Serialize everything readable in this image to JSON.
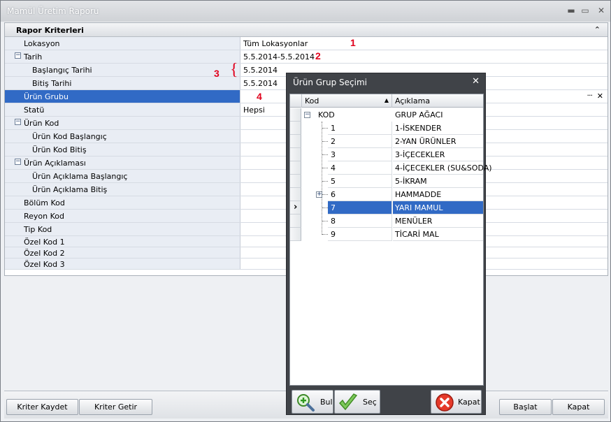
{
  "window": {
    "title": "Mamül Üretim Raporu"
  },
  "panel": {
    "title": "Rapor Kriterleri"
  },
  "rows": [
    {
      "label": "Lokasyon",
      "value": "Tüm Lokasyonlar",
      "level": 1,
      "expander": ""
    },
    {
      "label": "Tarih",
      "value": "5.5.2014-5.5.2014",
      "level": 0,
      "expander": "⊟"
    },
    {
      "label": "Başlangıç Tarihi",
      "value": "5.5.2014",
      "level": 2,
      "expander": ""
    },
    {
      "label": "Bitiş Tarihi",
      "value": "5.5.2014",
      "level": 2,
      "expander": ""
    },
    {
      "label": "Ürün Grubu",
      "value": "",
      "level": 1,
      "expander": ""
    },
    {
      "label": "Statü",
      "value": "Hepsi",
      "level": 1,
      "expander": ""
    },
    {
      "label": "Ürün Kod",
      "value": "",
      "level": 0,
      "expander": "⊟"
    },
    {
      "label": "Ürün Kod Başlangıç",
      "value": "",
      "level": 2,
      "expander": ""
    },
    {
      "label": "Ürün Kod Bitiş",
      "value": "",
      "level": 2,
      "expander": ""
    },
    {
      "label": "Ürün Açıklaması",
      "value": "",
      "level": 0,
      "expander": "⊟"
    },
    {
      "label": "Ürün Açıklama Başlangıç",
      "value": "",
      "level": 2,
      "expander": ""
    },
    {
      "label": "Ürün Açıklama Bitiş",
      "value": "",
      "level": 2,
      "expander": ""
    },
    {
      "label": "Bölüm Kod",
      "value": "",
      "level": 1,
      "expander": ""
    },
    {
      "label": "Reyon Kod",
      "value": "",
      "level": 1,
      "expander": ""
    },
    {
      "label": "Tip Kod",
      "value": "",
      "level": 1,
      "expander": ""
    },
    {
      "label": "Özel Kod 1",
      "value": "",
      "level": 1,
      "expander": ""
    },
    {
      "label": "Özel Kod 2",
      "value": "",
      "level": 1,
      "expander": ""
    },
    {
      "label": "Özel Kod 3",
      "value": "",
      "level": 1,
      "expander": ""
    }
  ],
  "selected_row": 4,
  "annotations": {
    "n1": "1",
    "n2": "2",
    "n3": "3",
    "n4": "4",
    "brace": "{"
  },
  "edit_glyphs": {
    "dots": "···",
    "clear": "✕"
  },
  "buttons": {
    "kriter_kaydet": "Kriter Kaydet",
    "kriter_getir": "Kriter Getir",
    "baslat": "Başlat",
    "kapat": "Kapat"
  },
  "dialog": {
    "title": "Ürün Grup Seçimi",
    "close": "✕",
    "col_kod": "Kod",
    "col_aciklama": "Açıklama",
    "sort_glyph": "▲",
    "root": {
      "kod": "KOD",
      "aciklama": "GRUP AĞACI"
    },
    "items": [
      {
        "kod": "1",
        "aciklama": "1-İSKENDER"
      },
      {
        "kod": "2",
        "aciklama": "2-YAN ÜRÜNLER"
      },
      {
        "kod": "3",
        "aciklama": "3-İÇECEKLER"
      },
      {
        "kod": "4",
        "aciklama": "4-İÇECEKLER (SU&SODA)"
      },
      {
        "kod": "5",
        "aciklama": "5-İKRAM"
      },
      {
        "kod": "6",
        "aciklama": "HAMMADDE"
      },
      {
        "kod": "7",
        "aciklama": "YARI MAMUL"
      },
      {
        "kod": "8",
        "aciklama": "MENÜLER"
      },
      {
        "kod": "9",
        "aciklama": "TİCARİ MAL"
      }
    ],
    "selected_item": 6,
    "buttons": {
      "bul": "Bul",
      "sec": "Seç",
      "kapat": "Kapat"
    }
  }
}
